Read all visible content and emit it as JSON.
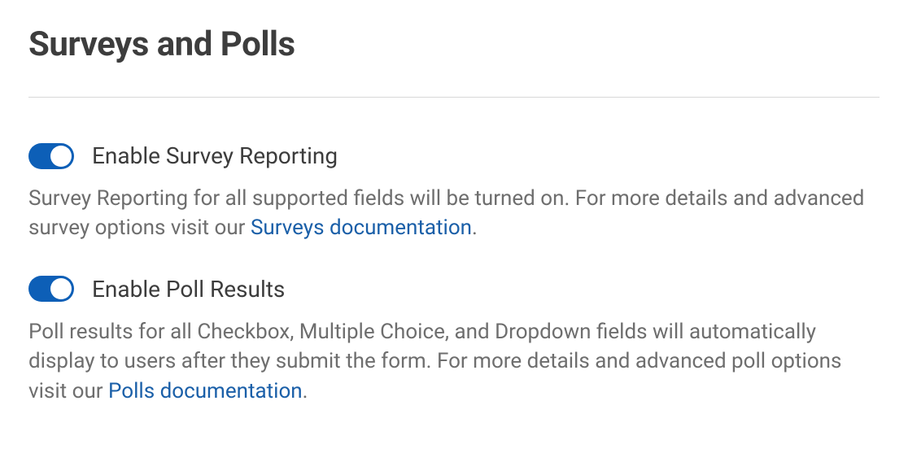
{
  "section": {
    "title": "Surveys and Polls"
  },
  "settings": {
    "survey": {
      "label": "Enable Survey Reporting",
      "description_pre": "Survey Reporting for all supported fields will be turned on. For more details and advanced survey options visit our ",
      "link_text": "Surveys documentation",
      "description_post": ".",
      "toggle_on": true
    },
    "poll": {
      "label": "Enable Poll Results",
      "description_pre": "Poll results for all Checkbox, Multiple Choice, and Dropdown fields will automatically display to users after they submit the form. For more details and advanced poll options visit our ",
      "link_text": "Polls documentation",
      "description_post": ".",
      "toggle_on": true
    }
  },
  "colors": {
    "toggle_active": "#0d5fb7",
    "link": "#1a5fa8",
    "heading": "#3d3d3d",
    "body_text": "#6e6e6e"
  }
}
